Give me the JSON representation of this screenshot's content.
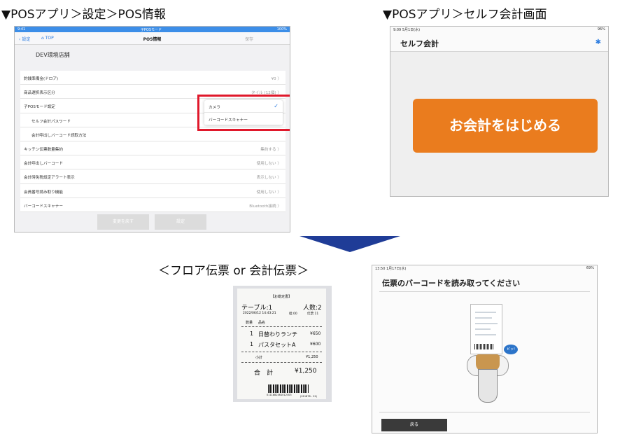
{
  "headings": {
    "left": "▼POSアプリ＞設定＞POS情報",
    "right": "▼POSアプリ＞セルフ会計画面",
    "middle": "＜フロア伝票 or 会計伝票＞"
  },
  "settings_screen": {
    "status": {
      "time": "9:41",
      "center": "子POSモード",
      "battery": "100%"
    },
    "nav": {
      "back": "設定",
      "top": "TOP",
      "title": "POS情報",
      "save": "保存"
    },
    "store_name": "DEV環境店舗",
    "rows": [
      {
        "label": "釣銭準備金(ドロア)",
        "value": "¥0 〉"
      },
      {
        "label": "商品選択表示区分",
        "value": "タイル (12個) 〉"
      },
      {
        "label": "子POSモード設定",
        "value": ""
      },
      {
        "label": "セルフ会計パスワード",
        "value": ""
      },
      {
        "label": "会計呼出しバーコード読取方法",
        "value": ""
      },
      {
        "label": "キッチン伝票数量集約",
        "value": "集約する 〉"
      },
      {
        "label": "会計呼出しバーコード",
        "value": "使用しない 〉"
      },
      {
        "label": "会計時免税設定アラート表示",
        "value": "表示しない 〉"
      },
      {
        "label": "会員番号読み取り機能",
        "value": "使用しない 〉"
      },
      {
        "label": "バーコードスキャナー",
        "value": "Bluetooth接続 〉"
      }
    ],
    "popup_options": [
      {
        "label": "カメラ",
        "checked": true
      },
      {
        "label": "バーコードスキャナー",
        "checked": false
      }
    ],
    "buttons": {
      "restore": "変更を戻す",
      "set": "設定"
    }
  },
  "self_checkout": {
    "status_left": "9:09  5月1日(水)",
    "status_right": "96%",
    "title": "セルフ会計",
    "gear_icon": "gear-icon",
    "start_button": "お会計をはじめる"
  },
  "receipt": {
    "header": "【お勘定書】",
    "table": "テーブル:1",
    "guests": "人数:2",
    "datetime": "2022/06/12 14:43:21",
    "seq": "担:00",
    "slip": "伝票:11",
    "col_qty": "数量",
    "col_name": "品名",
    "items": [
      {
        "qty": "1",
        "name": "日替わりランチ",
        "price": "¥650"
      },
      {
        "qty": "1",
        "name": "パスタセットA",
        "price": "¥600"
      }
    ],
    "subtotal_label": "小計",
    "subtotal": "¥1,250",
    "total_label": "合　計",
    "total": "¥1,250",
    "barcode_number": "0111882461012303",
    "footer": "(011878 - 01)"
  },
  "scan_screen": {
    "status_left": "13:50  1月17日(水)",
    "status_right": "69%",
    "title": "伝票のバーコードを読み取ってください",
    "beep": "ピッ!",
    "back_button": "戻る"
  },
  "colors": {
    "accent_blue": "#2a7be0",
    "orange": "#ea7c1e",
    "red_highlight": "#e0182b",
    "arrow_navy": "#1f3c97"
  }
}
